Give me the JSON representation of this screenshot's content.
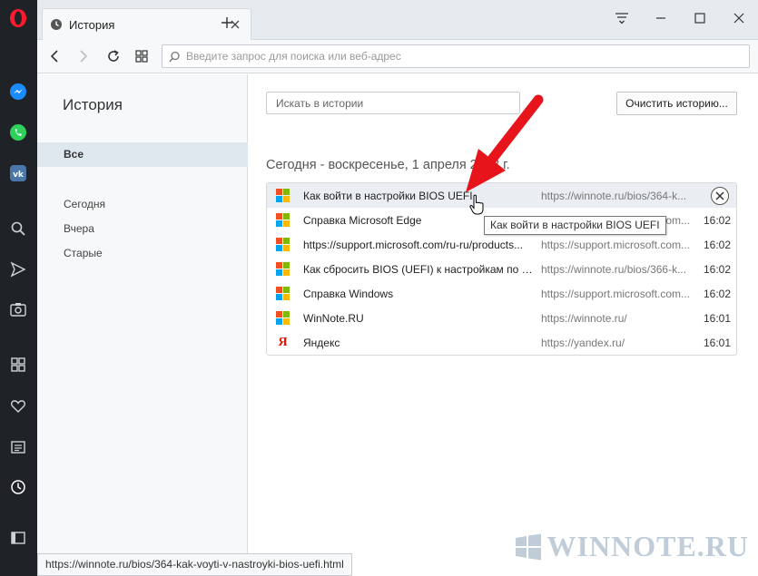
{
  "colors": {
    "opera_red": "#ff1b2d",
    "sidebar_bg": "#1f2327",
    "accent_arrow": "#e8141b"
  },
  "tab": {
    "title": "История"
  },
  "address": {
    "placeholder": "Введите запрос для поиска или веб-адрес"
  },
  "history_sidebar": {
    "title": "История",
    "nav": {
      "all": "Все",
      "today": "Сегодня",
      "yesterday": "Вчера",
      "older": "Старые"
    }
  },
  "main": {
    "search_placeholder": "Искать в истории",
    "clear_button": "Очистить историю...",
    "date_heading": "Сегодня - воскресенье, 1 апреля 2018 г.",
    "rows": [
      {
        "icon": "windows-icon",
        "title": "Как войти в настройки BIOS UEFI",
        "url": "https://winnote.ru/bios/364-k...",
        "time": ""
      },
      {
        "icon": "windows-icon",
        "title": "Справка Microsoft Edge",
        "url": "https://support.microsoft.com...",
        "time": "16:02"
      },
      {
        "icon": "windows-icon",
        "title": "https://support.microsoft.com/ru-ru/products...",
        "url": "https://support.microsoft.com...",
        "time": "16:02"
      },
      {
        "icon": "windows-icon",
        "title": "Как сбросить BIOS (UEFI) к настройкам по у...",
        "url": "https://winnote.ru/bios/366-k...",
        "time": "16:02"
      },
      {
        "icon": "windows-icon",
        "title": "Справка Windows",
        "url": "https://support.microsoft.com...",
        "time": "16:02"
      },
      {
        "icon": "windows-icon",
        "title": "WinNote.RU",
        "url": "https://winnote.ru/",
        "time": "16:01"
      },
      {
        "icon": "yandex-icon",
        "title": "Яндекс",
        "url": "https://yandex.ru/",
        "time": "16:01"
      }
    ]
  },
  "tooltip": "Как войти в настройки BIOS UEFI",
  "status_url": "https://winnote.ru/bios/364-kak-voyti-v-nastroyki-bios-uefi.html",
  "watermark": "WINNOTE.RU"
}
